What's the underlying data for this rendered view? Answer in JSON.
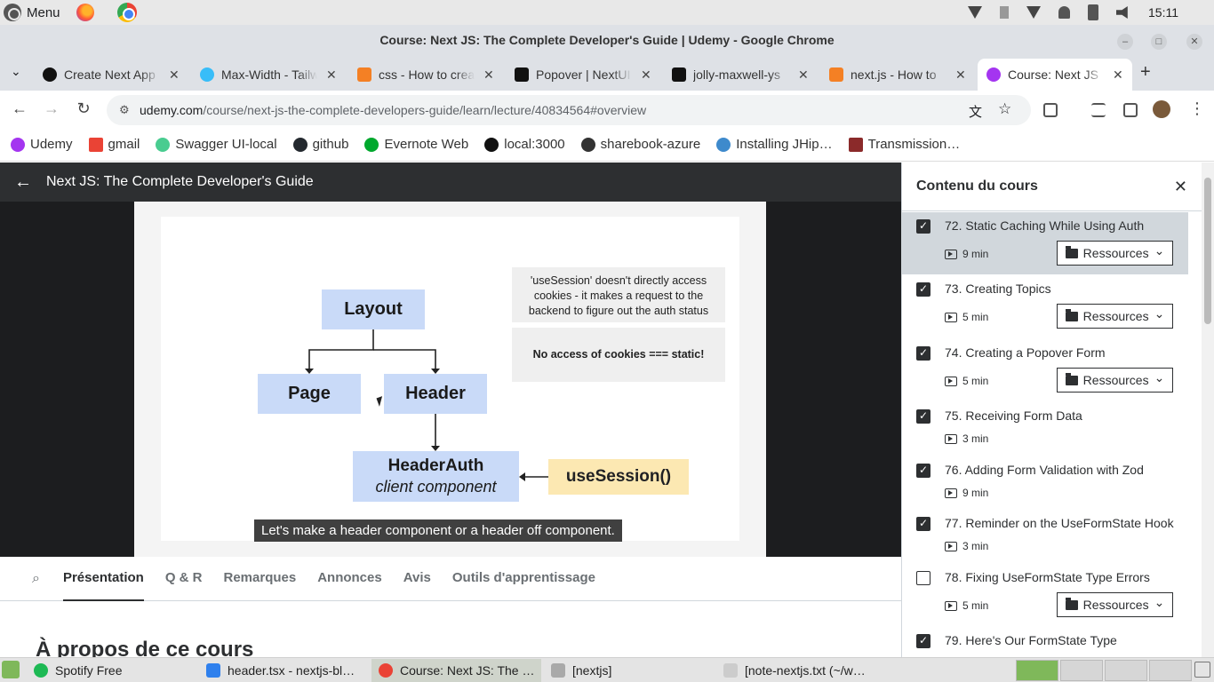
{
  "os": {
    "menu_label": "Menu",
    "clock": "15:11"
  },
  "window": {
    "title": "Course: Next JS: The Complete Developer's Guide | Udemy - Google Chrome"
  },
  "tabs": [
    {
      "label": "Create Next App",
      "color": "#111111"
    },
    {
      "label": "Max-Width - Tailwind",
      "color": "#38bdf8"
    },
    {
      "label": "css - How to create",
      "color": "#f48024"
    },
    {
      "label": "Popover | NextUI",
      "color": "#111111"
    },
    {
      "label": "jolly-maxwell-ys",
      "color": "#111111"
    },
    {
      "label": "next.js - How to",
      "color": "#f48024"
    },
    {
      "label": "Course: Next JS",
      "color": "#a435f0"
    }
  ],
  "address": {
    "host": "udemy.com",
    "path": "/course/next-js-the-complete-developers-guide/learn/lecture/40834564#overview"
  },
  "bookmarks": [
    {
      "label": "Udemy",
      "color": "#a435f0"
    },
    {
      "label": "gmail",
      "color": "#ea4335"
    },
    {
      "label": "Swagger UI-local",
      "color": "#49cc90"
    },
    {
      "label": "github",
      "color": "#24292f"
    },
    {
      "label": "Evernote Web",
      "color": "#00a82d"
    },
    {
      "label": "local:3000",
      "color": "#111111"
    },
    {
      "label": "sharebook-azure",
      "color": "#333333"
    },
    {
      "label": "Installing JHip…",
      "color": "#3e8acc"
    },
    {
      "label": "Transmission…",
      "color": "#8b2a2a"
    }
  ],
  "course": {
    "title": "Next JS: The Complete Developer's Guide"
  },
  "slide": {
    "layout": "Layout",
    "page": "Page",
    "header": "Header",
    "header_auth": "HeaderAuth",
    "client_component": "client component",
    "use_session": "useSession()",
    "note_1": "'useSession' doesn't directly access cookies - it makes a request to the backend to figure out the auth status",
    "note_2": "No access of cookies === static!"
  },
  "subtitle": "Let's make a header component or a header off component.",
  "lecture_tabs": [
    "Présentation",
    "Q & R",
    "Remarques",
    "Annonces",
    "Avis",
    "Outils d'apprentissage"
  ],
  "about_title": "À propos de ce cours",
  "sidebar": {
    "title": "Contenu du cours",
    "resources_label": "Ressources",
    "lectures": [
      {
        "title": "72. Static Caching While Using Auth",
        "duration": "9 min",
        "checked": true,
        "resources": true,
        "current": true
      },
      {
        "title": "73. Creating Topics",
        "duration": "5 min",
        "checked": true,
        "resources": true,
        "current": false
      },
      {
        "title": "74. Creating a Popover Form",
        "duration": "5 min",
        "checked": true,
        "resources": true,
        "current": false
      },
      {
        "title": "75. Receiving Form Data",
        "duration": "3 min",
        "checked": true,
        "resources": false,
        "current": false
      },
      {
        "title": "76. Adding Form Validation with Zod",
        "duration": "9 min",
        "checked": true,
        "resources": false,
        "current": false
      },
      {
        "title": "77. Reminder on the UseFormState Hook",
        "duration": "3 min",
        "checked": true,
        "resources": false,
        "current": false
      },
      {
        "title": "78. Fixing UseFormState Type Errors",
        "duration": "5 min",
        "checked": false,
        "resources": true,
        "current": false
      },
      {
        "title": "79. Here's Our FormState Type",
        "duration": "",
        "checked": true,
        "resources": false,
        "current": false
      }
    ]
  },
  "taskbar": [
    {
      "label": "Spotify Free",
      "color": "#1db954"
    },
    {
      "label": "header.tsx - nextjs-bl…",
      "color": "#2f80ed"
    },
    {
      "label": "Course: Next JS: The …",
      "color": "#ea4335"
    },
    {
      "label": "[nextjs]",
      "color": "#a9a9a9"
    },
    {
      "label": "[note-nextjs.txt (~/w…",
      "color": "#cccccc"
    }
  ]
}
